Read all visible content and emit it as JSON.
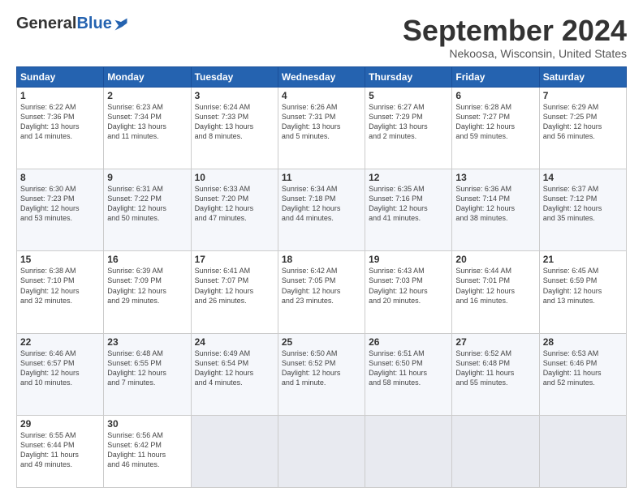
{
  "logo": {
    "general": "General",
    "blue": "Blue"
  },
  "title": "September 2024",
  "location": "Nekoosa, Wisconsin, United States",
  "headers": [
    "Sunday",
    "Monday",
    "Tuesday",
    "Wednesday",
    "Thursday",
    "Friday",
    "Saturday"
  ],
  "weeks": [
    [
      {
        "num": "1",
        "info": "Sunrise: 6:22 AM\nSunset: 7:36 PM\nDaylight: 13 hours\nand 14 minutes."
      },
      {
        "num": "2",
        "info": "Sunrise: 6:23 AM\nSunset: 7:34 PM\nDaylight: 13 hours\nand 11 minutes."
      },
      {
        "num": "3",
        "info": "Sunrise: 6:24 AM\nSunset: 7:33 PM\nDaylight: 13 hours\nand 8 minutes."
      },
      {
        "num": "4",
        "info": "Sunrise: 6:26 AM\nSunset: 7:31 PM\nDaylight: 13 hours\nand 5 minutes."
      },
      {
        "num": "5",
        "info": "Sunrise: 6:27 AM\nSunset: 7:29 PM\nDaylight: 13 hours\nand 2 minutes."
      },
      {
        "num": "6",
        "info": "Sunrise: 6:28 AM\nSunset: 7:27 PM\nDaylight: 12 hours\nand 59 minutes."
      },
      {
        "num": "7",
        "info": "Sunrise: 6:29 AM\nSunset: 7:25 PM\nDaylight: 12 hours\nand 56 minutes."
      }
    ],
    [
      {
        "num": "8",
        "info": "Sunrise: 6:30 AM\nSunset: 7:23 PM\nDaylight: 12 hours\nand 53 minutes."
      },
      {
        "num": "9",
        "info": "Sunrise: 6:31 AM\nSunset: 7:22 PM\nDaylight: 12 hours\nand 50 minutes."
      },
      {
        "num": "10",
        "info": "Sunrise: 6:33 AM\nSunset: 7:20 PM\nDaylight: 12 hours\nand 47 minutes."
      },
      {
        "num": "11",
        "info": "Sunrise: 6:34 AM\nSunset: 7:18 PM\nDaylight: 12 hours\nand 44 minutes."
      },
      {
        "num": "12",
        "info": "Sunrise: 6:35 AM\nSunset: 7:16 PM\nDaylight: 12 hours\nand 41 minutes."
      },
      {
        "num": "13",
        "info": "Sunrise: 6:36 AM\nSunset: 7:14 PM\nDaylight: 12 hours\nand 38 minutes."
      },
      {
        "num": "14",
        "info": "Sunrise: 6:37 AM\nSunset: 7:12 PM\nDaylight: 12 hours\nand 35 minutes."
      }
    ],
    [
      {
        "num": "15",
        "info": "Sunrise: 6:38 AM\nSunset: 7:10 PM\nDaylight: 12 hours\nand 32 minutes."
      },
      {
        "num": "16",
        "info": "Sunrise: 6:39 AM\nSunset: 7:09 PM\nDaylight: 12 hours\nand 29 minutes."
      },
      {
        "num": "17",
        "info": "Sunrise: 6:41 AM\nSunset: 7:07 PM\nDaylight: 12 hours\nand 26 minutes."
      },
      {
        "num": "18",
        "info": "Sunrise: 6:42 AM\nSunset: 7:05 PM\nDaylight: 12 hours\nand 23 minutes."
      },
      {
        "num": "19",
        "info": "Sunrise: 6:43 AM\nSunset: 7:03 PM\nDaylight: 12 hours\nand 20 minutes."
      },
      {
        "num": "20",
        "info": "Sunrise: 6:44 AM\nSunset: 7:01 PM\nDaylight: 12 hours\nand 16 minutes."
      },
      {
        "num": "21",
        "info": "Sunrise: 6:45 AM\nSunset: 6:59 PM\nDaylight: 12 hours\nand 13 minutes."
      }
    ],
    [
      {
        "num": "22",
        "info": "Sunrise: 6:46 AM\nSunset: 6:57 PM\nDaylight: 12 hours\nand 10 minutes."
      },
      {
        "num": "23",
        "info": "Sunrise: 6:48 AM\nSunset: 6:55 PM\nDaylight: 12 hours\nand 7 minutes."
      },
      {
        "num": "24",
        "info": "Sunrise: 6:49 AM\nSunset: 6:54 PM\nDaylight: 12 hours\nand 4 minutes."
      },
      {
        "num": "25",
        "info": "Sunrise: 6:50 AM\nSunset: 6:52 PM\nDaylight: 12 hours\nand 1 minute."
      },
      {
        "num": "26",
        "info": "Sunrise: 6:51 AM\nSunset: 6:50 PM\nDaylight: 11 hours\nand 58 minutes."
      },
      {
        "num": "27",
        "info": "Sunrise: 6:52 AM\nSunset: 6:48 PM\nDaylight: 11 hours\nand 55 minutes."
      },
      {
        "num": "28",
        "info": "Sunrise: 6:53 AM\nSunset: 6:46 PM\nDaylight: 11 hours\nand 52 minutes."
      }
    ],
    [
      {
        "num": "29",
        "info": "Sunrise: 6:55 AM\nSunset: 6:44 PM\nDaylight: 11 hours\nand 49 minutes."
      },
      {
        "num": "30",
        "info": "Sunrise: 6:56 AM\nSunset: 6:42 PM\nDaylight: 11 hours\nand 46 minutes."
      },
      null,
      null,
      null,
      null,
      null
    ]
  ]
}
